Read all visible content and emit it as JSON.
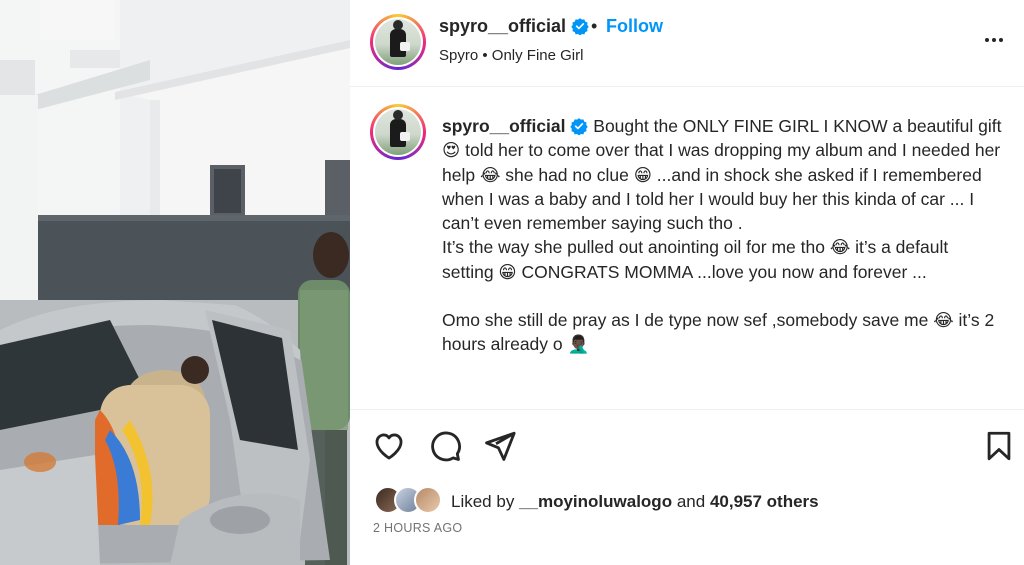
{
  "post": {
    "username": "spyro__official",
    "follow_label": "Follow",
    "separator": "•",
    "audio_line": "Spyro • Only Fine Girl"
  },
  "caption": {
    "username": "spyro__official",
    "paragraph1": "Bought the ONLY FINE GIRL I KNOW a beautiful gift 😍 told her to come over that I was dropping my album and I needed her help 😂 she had no clue 😁 ...and in shock she asked if I remembered when I was a baby and I told her I would buy her this kinda of car ... I can’t even remember saying such tho .",
    "paragraph2": "It’s the way she pulled out anointing oil for me tho 😂 it’s a default setting 😁 CONGRATS MOMMA ...love you now and forever ...",
    "paragraph3": "Omo she still de pray as I de type now sef ,somebody save me 😂 it’s 2 hours already o 🤦🏿‍♂️"
  },
  "actions": {
    "like_icon": "heart-icon",
    "comment_icon": "comment-icon",
    "share_icon": "send-icon",
    "save_icon": "bookmark-icon"
  },
  "likes": {
    "prefix": "Liked by",
    "user": "__moyinoluwalogo",
    "joiner": "and",
    "count": "40,957 others"
  },
  "timestamp": "2 HOURS AGO",
  "colors": {
    "link_blue": "#0095f6",
    "text": "#262626",
    "muted": "#737373",
    "verified_blue": "#0095f6"
  }
}
